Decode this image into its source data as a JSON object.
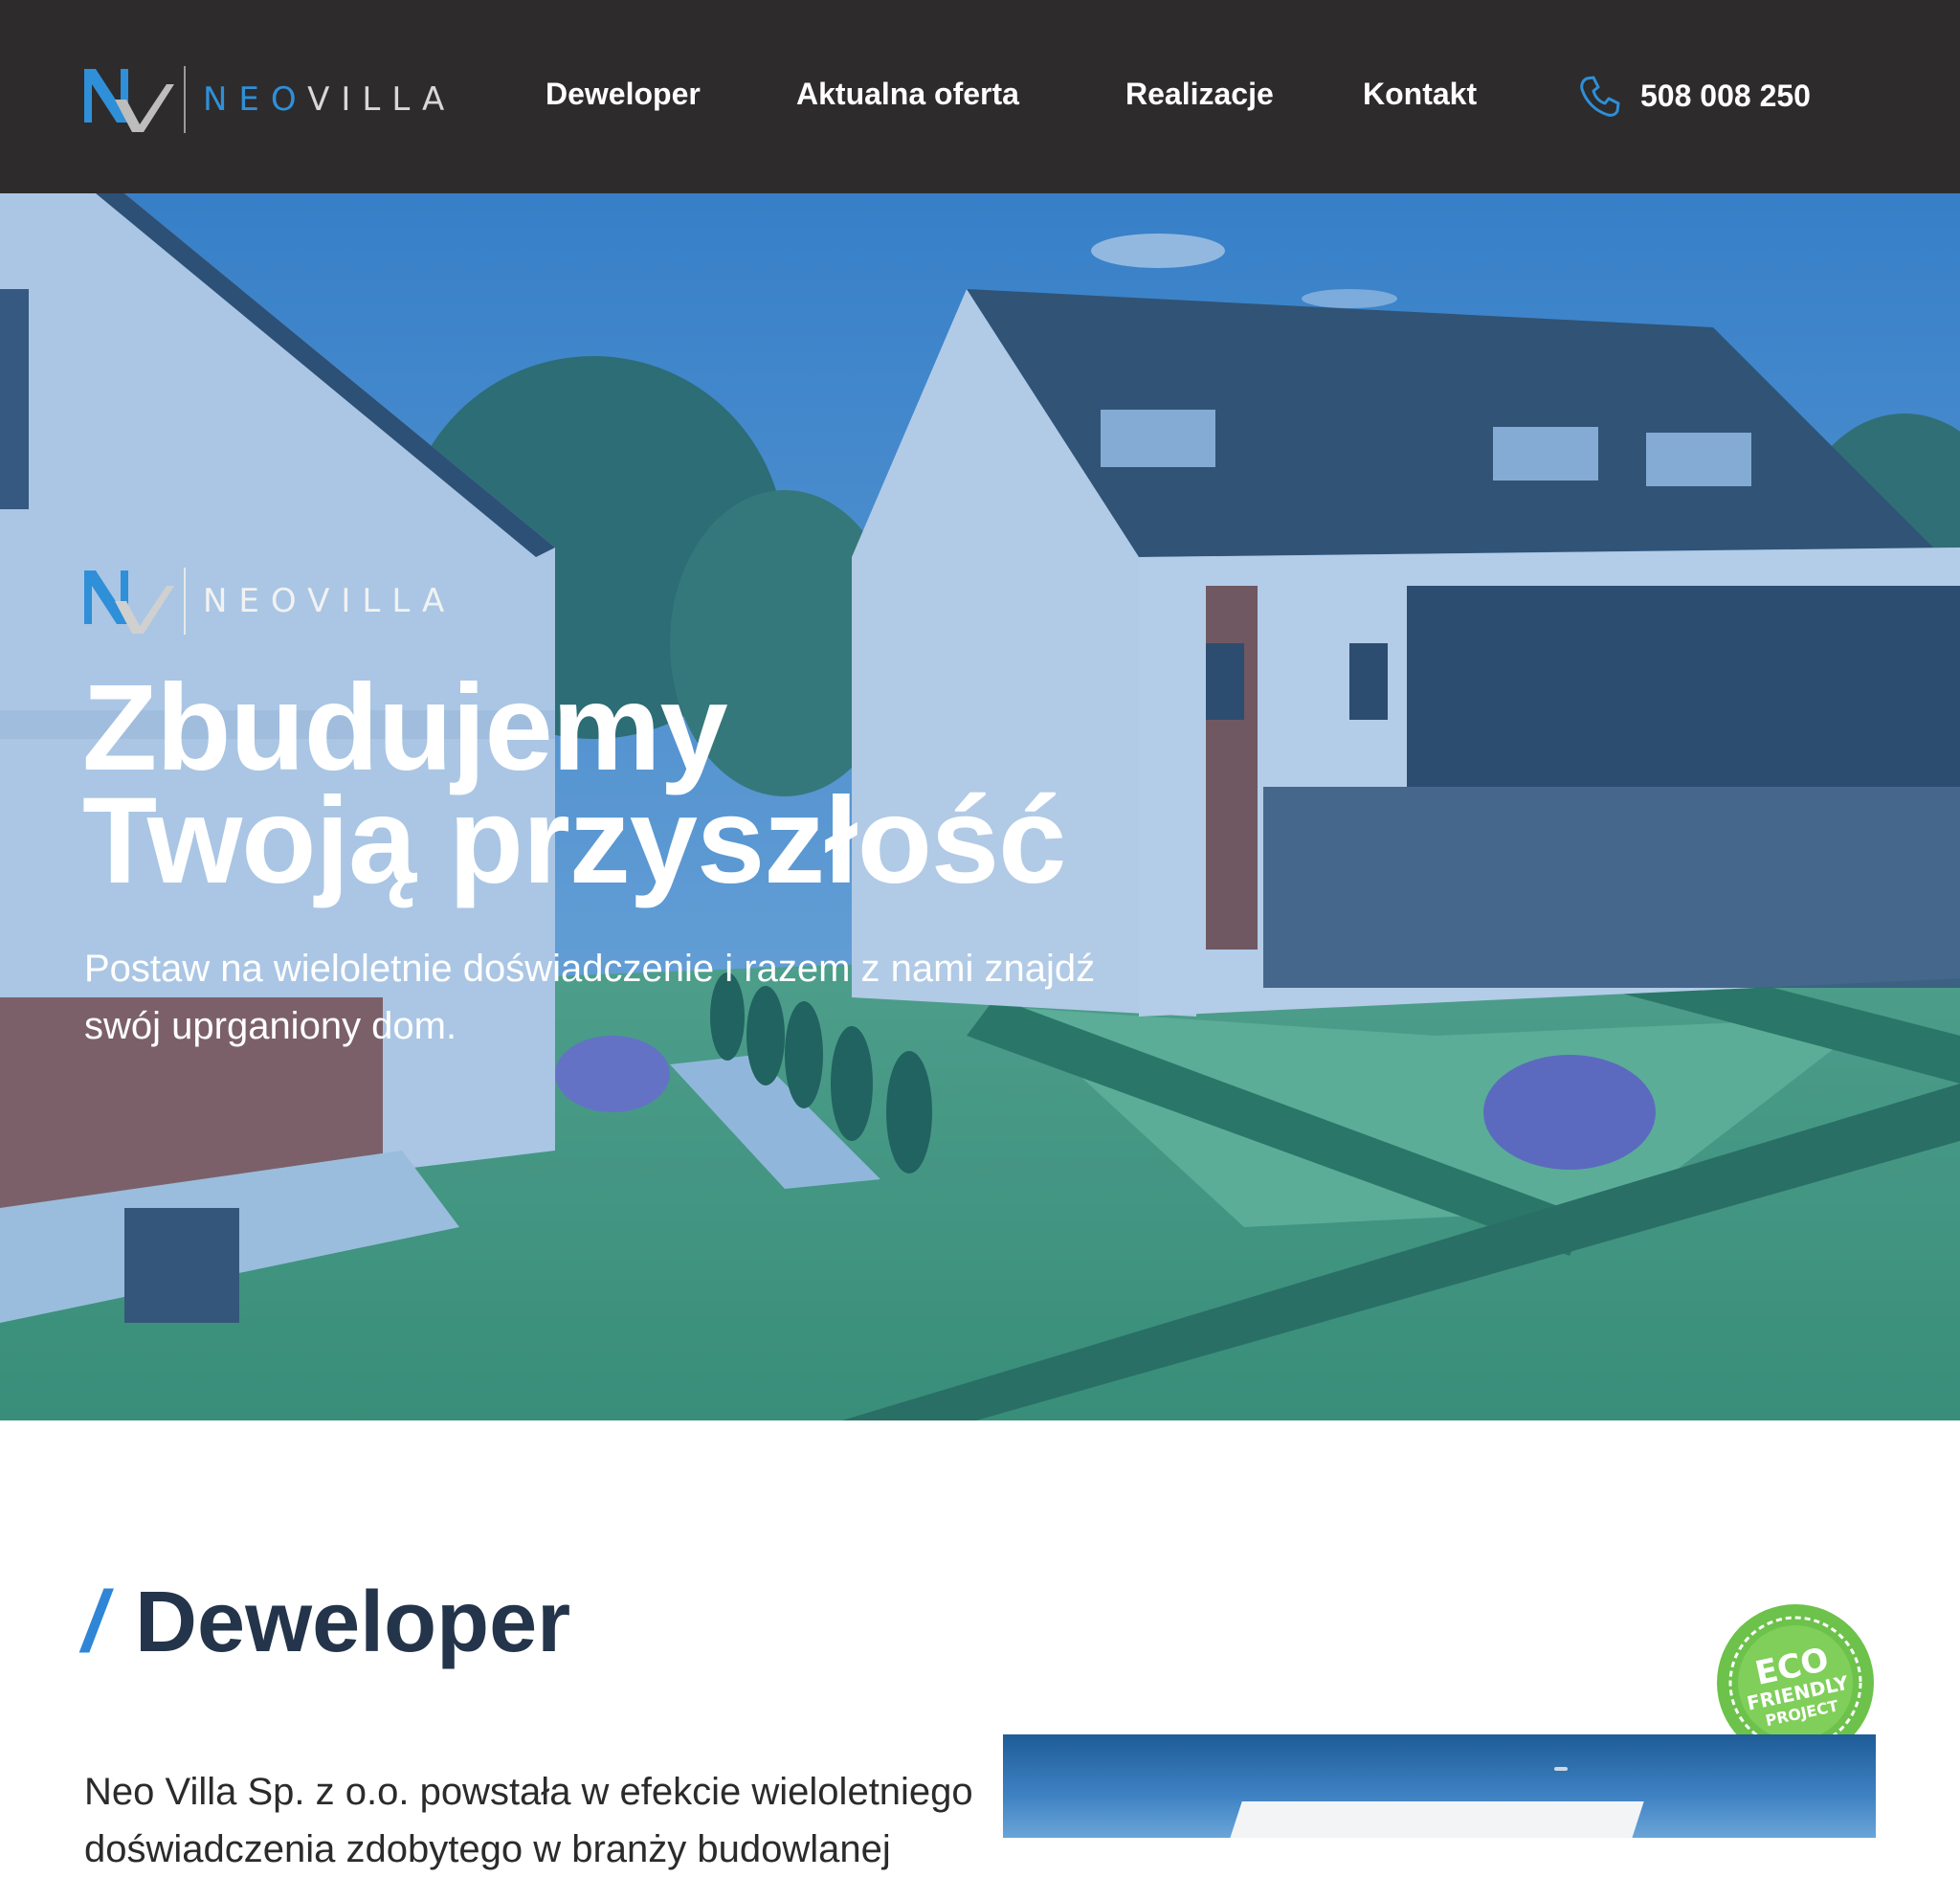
{
  "brand": {
    "logo_neo": "NEO",
    "logo_villa": "VILLA",
    "logo_mark": "NV"
  },
  "nav": {
    "items": [
      {
        "label": "Deweloper"
      },
      {
        "label": "Aktualna oferta"
      },
      {
        "label": "Realizacje"
      },
      {
        "label": "Kontakt"
      }
    ],
    "phone": "508 008 250"
  },
  "hero": {
    "title_line1": "Zbudujemy",
    "title_line2": "Twoją przyszłość",
    "subtitle": "Postaw na wieloletnie doświadczenie i razem z nami znajdź swój uprganiony dom."
  },
  "developer": {
    "slash": "/",
    "heading": "Deweloper",
    "paragraph": "Neo Villa Sp. z o.o. powstała w efekcie wieloletniego doświadczenia zdobytego w branży budowlanej",
    "badge": {
      "line1": "ECO",
      "line2": "FRIENDLY",
      "line3": "PROJECT",
      "ring": "ECO FRIENDLY PROJECT"
    }
  },
  "icons": {
    "logo": "nv-monogram-icon",
    "phone": "phone-handset-icon",
    "badge": "eco-friendly-badge-icon"
  },
  "colors": {
    "header_bg": "#2d2b2c",
    "accent_blue": "#2f86d6",
    "heading_dark": "#24344a",
    "eco_green": "#6cc24a"
  }
}
